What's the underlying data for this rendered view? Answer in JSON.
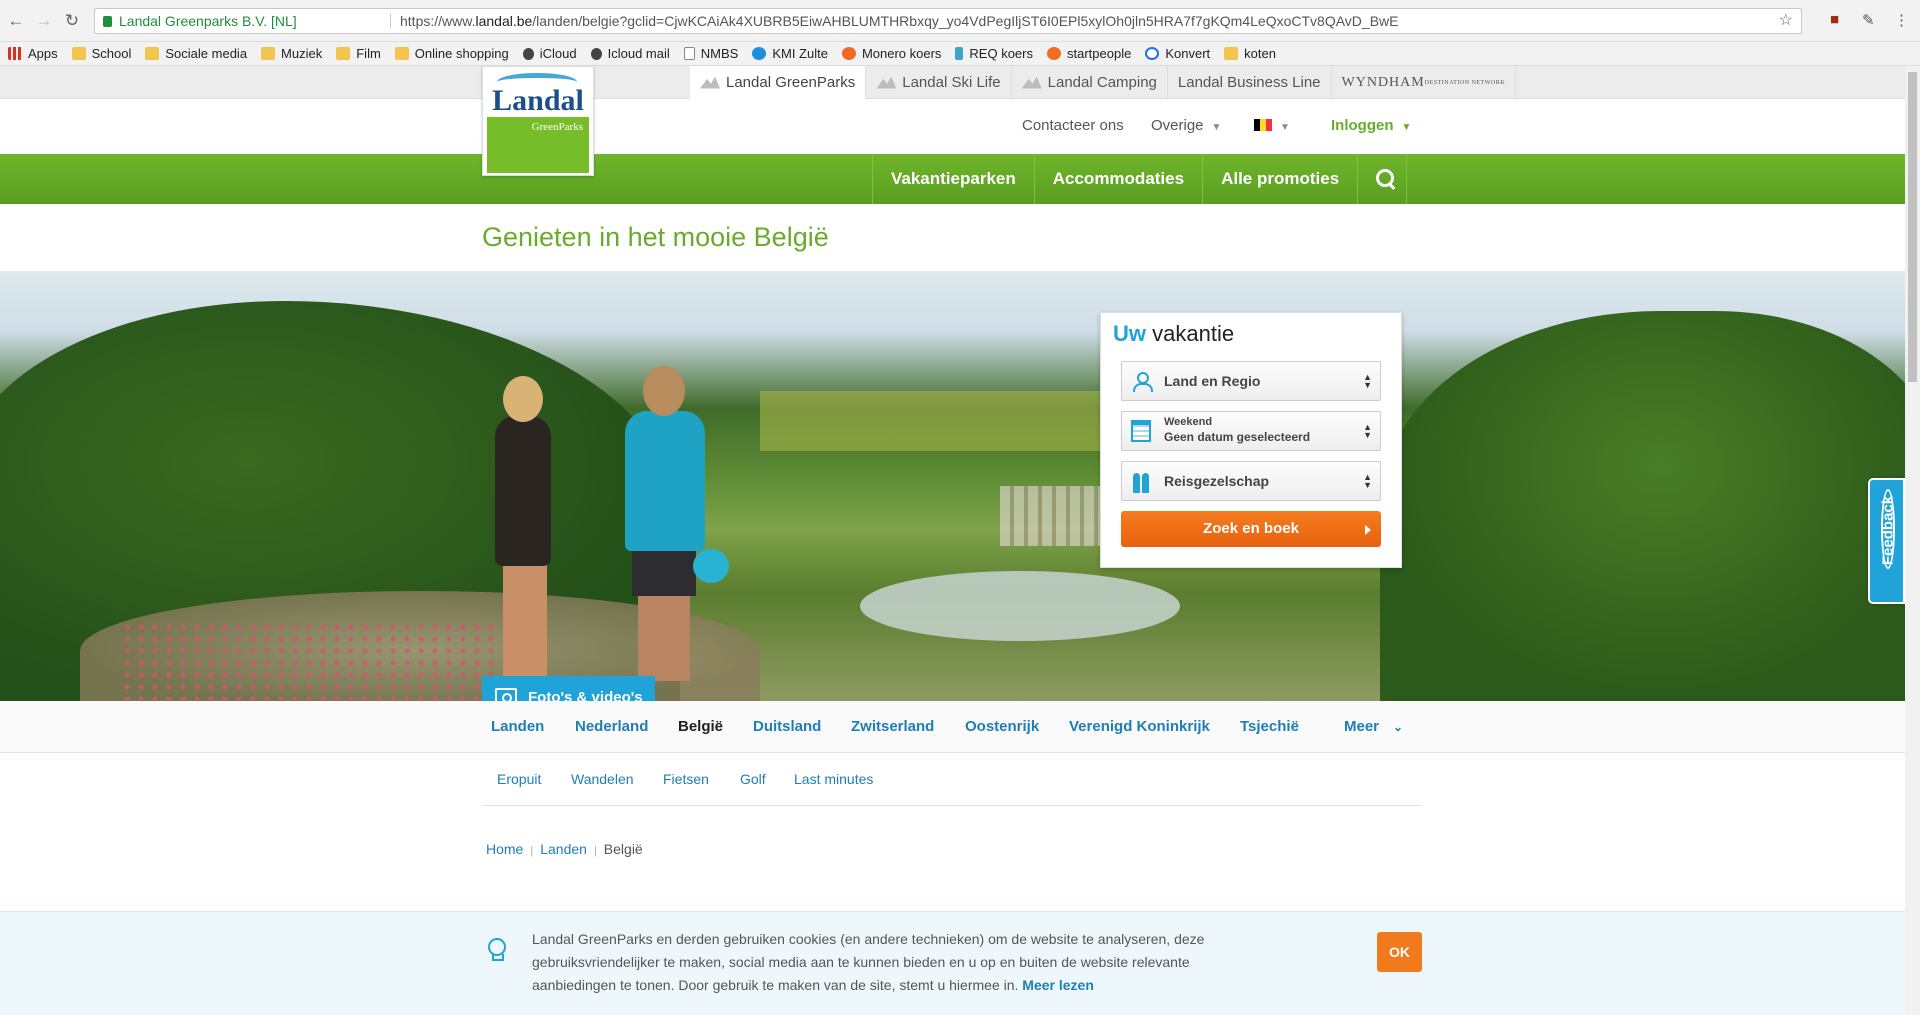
{
  "browser": {
    "secure_label": "Landal Greenparks B.V. [NL]",
    "url_prefix": "https://www.",
    "url_domain": "landal.be",
    "url_path": "/landen/belgie?gclid=CjwKCAiAk4XUBRB5EiwAHBLUMTHRbxqy_yo4VdPegIljST6I0EPl5xylOh0jln5HRA7f7gKQm4LeQxoCTv8QAvD_BwE"
  },
  "bookmarks": [
    {
      "label": "Apps",
      "icon": "apps-icon"
    },
    {
      "label": "School",
      "icon": "folder-icon"
    },
    {
      "label": "Sociale media",
      "icon": "folder-icon"
    },
    {
      "label": "Muziek",
      "icon": "folder-icon"
    },
    {
      "label": "Film",
      "icon": "folder-icon"
    },
    {
      "label": "Online shopping",
      "icon": "folder-icon"
    },
    {
      "label": "iCloud",
      "icon": "apple-icon"
    },
    {
      "label": "Icloud mail",
      "icon": "apple-icon"
    },
    {
      "label": "NMBS",
      "icon": "page-icon"
    },
    {
      "label": "KMI Zulte",
      "icon": "kmi-icon"
    },
    {
      "label": "Monero koers",
      "icon": "monero-icon"
    },
    {
      "label": "REQ koers",
      "icon": "req-icon"
    },
    {
      "label": "startpeople",
      "icon": "startpeople-icon"
    },
    {
      "label": "Konvert",
      "icon": "konvert-icon"
    },
    {
      "label": "koten",
      "icon": "folder-icon"
    }
  ],
  "brand_tabs": [
    "Landal GreenParks",
    "Landal Ski Life",
    "Landal Camping",
    "Landal Business Line"
  ],
  "wyndham": {
    "name": "WYNDHAM",
    "tagline": "DESTINATION NETWORK"
  },
  "logo": {
    "word": "Landal",
    "sub": "GreenParks"
  },
  "utility": {
    "contact": "Contacteer ons",
    "other": "Overige",
    "login": "Inloggen"
  },
  "mainnav": {
    "parks": "Vakantieparken",
    "accommodations": "Accommodaties",
    "promotions": "Alle promoties"
  },
  "headline": "Genieten in het mooie België",
  "hero": {
    "media_button": "Foto's & video's"
  },
  "booking": {
    "title_accent": "Uw",
    "title_rest": "vakantie",
    "region": "Land en Regio",
    "date_label": "Weekend",
    "date_value": "Geen datum geselecteerd",
    "party": "Reisgezelschap",
    "submit": "Zoek en boek"
  },
  "feedback": "Feedback",
  "countries": {
    "items": [
      "Landen",
      "Nederland",
      "België",
      "Duitsland",
      "Zwitserland",
      "Oostenrijk",
      "Verenigd Koninkrijk",
      "Tsjechië"
    ],
    "more": "Meer",
    "active": "België"
  },
  "subnav": [
    "Eropuit",
    "Wandelen",
    "Fietsen",
    "Golf",
    "Last minutes"
  ],
  "breadcrumb": [
    "Home",
    "Landen",
    "België"
  ],
  "cookie": {
    "text": "Landal GreenParks en derden gebruiken cookies (en andere technieken) om de website te analyseren, deze gebruiksvriendelijker te maken, social media aan te kunnen bieden en u op en buiten de website relevante aanbiedingen te tonen. Door gebruik te maken van de site, stemt u hiermee in.",
    "more": "Meer lezen",
    "ok": "OK"
  },
  "colors": {
    "green": "#6aab2e",
    "blue": "#1fa3d9",
    "orange": "#f07a1c",
    "link": "#1f7fb2"
  }
}
